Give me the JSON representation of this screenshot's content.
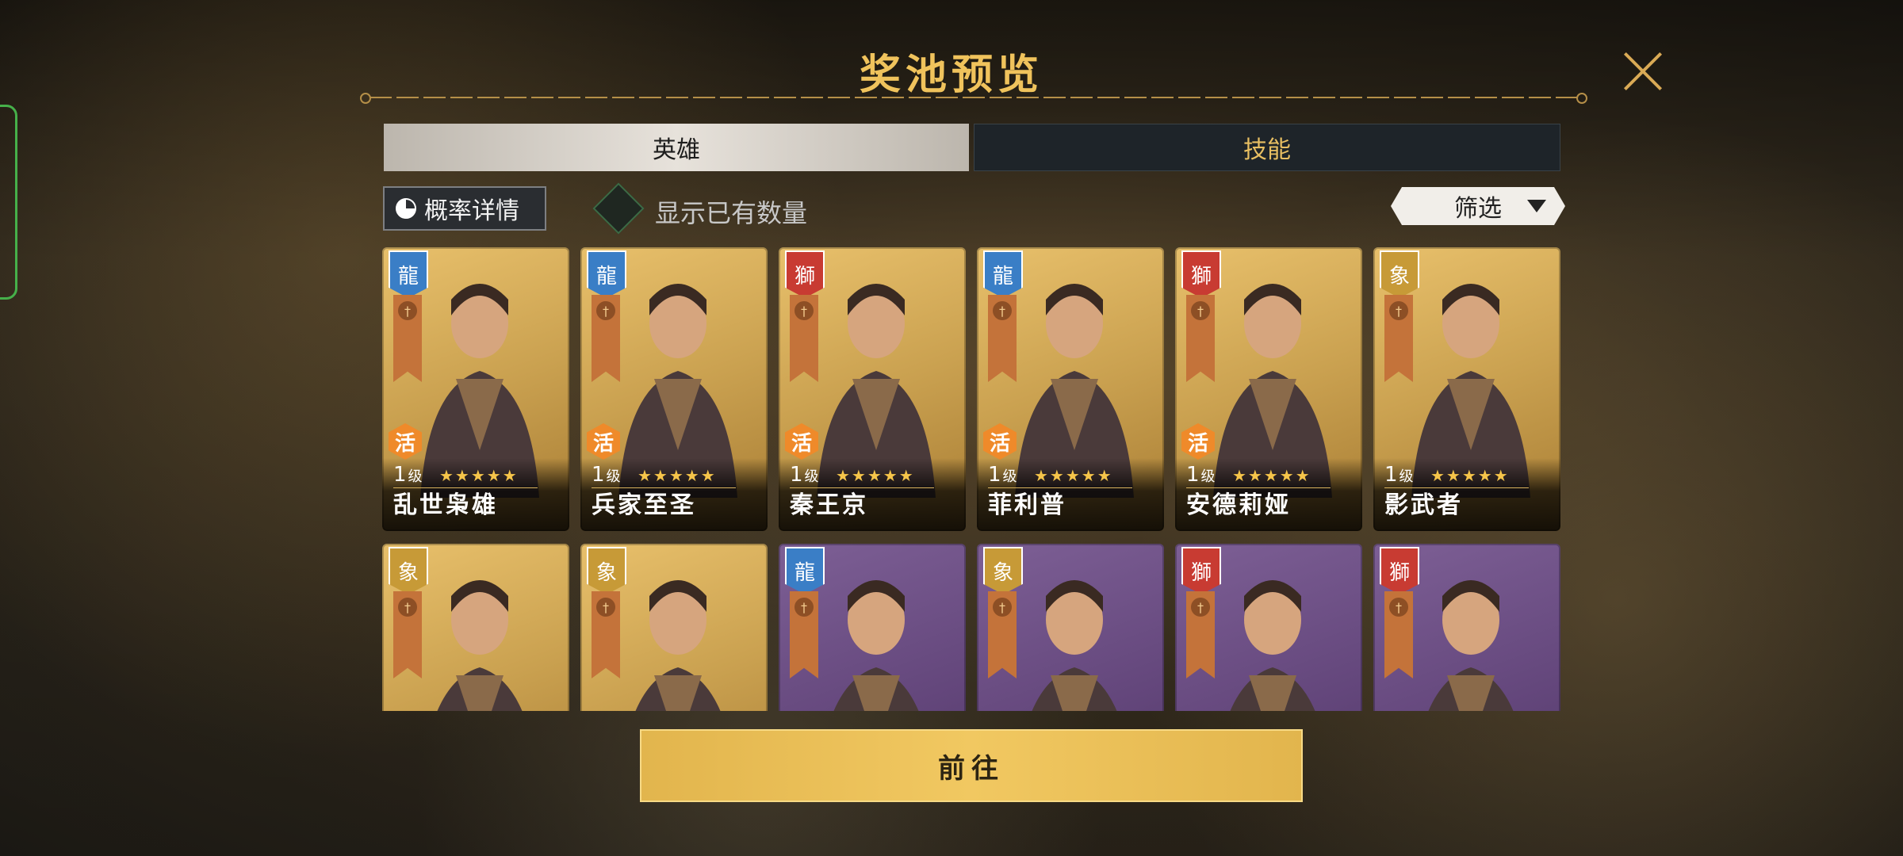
{
  "title": "奖池预览",
  "tabs": [
    {
      "label": "英雄",
      "active": true
    },
    {
      "label": "技能",
      "active": false
    }
  ],
  "rate_button": "概率详情",
  "show_owned": {
    "label": "显示已有数量",
    "checked": false
  },
  "filter": {
    "label": "筛选"
  },
  "heroes": [
    {
      "name": "乱世枭雄",
      "level": "1",
      "level_unit": "级",
      "stars": "★★★★★",
      "faction": "blue",
      "badge": "活",
      "frame": "gold"
    },
    {
      "name": "兵家至圣",
      "level": "1",
      "level_unit": "级",
      "stars": "★★★★★",
      "faction": "blue",
      "badge": "活",
      "frame": "gold"
    },
    {
      "name": "秦王京",
      "level": "1",
      "level_unit": "级",
      "stars": "★★★★★",
      "faction": "red",
      "badge": "活",
      "frame": "gold"
    },
    {
      "name": "菲利普",
      "level": "1",
      "level_unit": "级",
      "stars": "★★★★★",
      "faction": "blue",
      "badge": "活",
      "frame": "gold"
    },
    {
      "name": "安德莉娅",
      "level": "1",
      "level_unit": "级",
      "stars": "★★★★★",
      "faction": "red",
      "badge": "活",
      "frame": "gold"
    },
    {
      "name": "影武者",
      "level": "1",
      "level_unit": "级",
      "stars": "★★★★★",
      "faction": "gold",
      "badge": "",
      "frame": "gold"
    },
    {
      "faction": "gold",
      "frame": "gold"
    },
    {
      "faction": "gold",
      "frame": "gold"
    },
    {
      "faction": "blue",
      "frame": "purple"
    },
    {
      "faction": "gold",
      "frame": "purple"
    },
    {
      "faction": "red",
      "frame": "purple"
    },
    {
      "faction": "red",
      "frame": "purple"
    }
  ],
  "go_button": "前往",
  "colors": {
    "accent_gold": "#f0c35c",
    "button_gold": "#f1c861",
    "purple_frame": "#63467b",
    "gold_frame": "#caa150"
  }
}
